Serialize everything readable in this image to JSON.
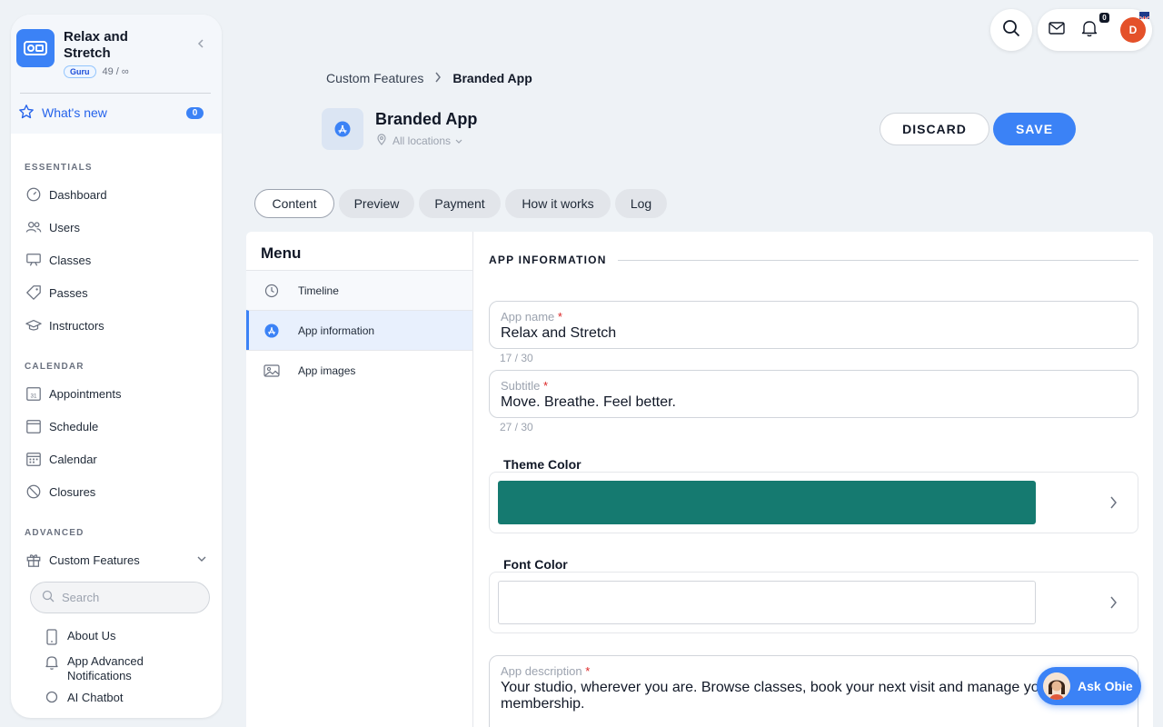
{
  "sidebar": {
    "brand_name": "Relax and Stretch",
    "plan_badge": "Guru",
    "plan_usage": "49 / ∞",
    "whats_new_label": "What's new",
    "whats_new_count": "0",
    "sections": {
      "essentials": "ESSENTIALS",
      "calendar": "CALENDAR",
      "advanced": "ADVANCED"
    },
    "essentials_items": [
      "Dashboard",
      "Users",
      "Classes",
      "Passes",
      "Instructors"
    ],
    "calendar_items": [
      "Appointments",
      "Schedule",
      "Calendar",
      "Closures"
    ],
    "custom_features_label": "Custom Features",
    "search_placeholder": "Search",
    "sub_items": [
      "About Us",
      "App Advanced Notifications",
      "AI Chatbot"
    ]
  },
  "topbar": {
    "notification_count": "0",
    "avatar_initial": "D"
  },
  "header": {
    "breadcrumb_parent": "Custom Features",
    "breadcrumb_current": "Branded App",
    "title": "Branded App",
    "locations_label": "All locations",
    "discard_label": "DISCARD",
    "save_label": "SAVE"
  },
  "tabs": [
    "Content",
    "Preview",
    "Payment",
    "How it works",
    "Log"
  ],
  "menu": {
    "title": "Menu",
    "items": [
      "Timeline",
      "App information",
      "App images"
    ]
  },
  "form": {
    "section_title": "APP INFORMATION",
    "app_name_label": "App name",
    "app_name_value": "Relax and Stretch",
    "app_name_counter": "17 / 30",
    "subtitle_label": "Subtitle",
    "subtitle_value": "Move. Breathe. Feel better.",
    "subtitle_counter": "27 / 30",
    "theme_color_label": "Theme Color",
    "theme_color": "#157a70",
    "font_color_label": "Font Color",
    "font_color": "#ffffff",
    "description_label": "App description",
    "description_value": "Your studio, wherever you are. Browse classes, book your next visit and manage your membership."
  },
  "assistant": {
    "label": "Ask Obie"
  },
  "colors": {
    "accent": "#3b82f6"
  }
}
